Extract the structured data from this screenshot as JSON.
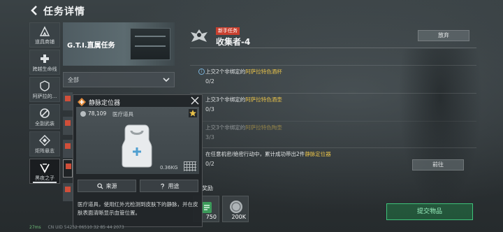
{
  "header": {
    "title": "任务详情"
  },
  "rail": {
    "items": [
      {
        "label": "道具商铺",
        "icon": "summit-icon"
      },
      {
        "label": "跨越生命线",
        "icon": "cross-icon"
      },
      {
        "label": "阿萨拉的...",
        "icon": "shield-icon"
      },
      {
        "label": "全副武装",
        "icon": "no-entry-icon"
      },
      {
        "label": "炬阵悬志",
        "icon": "diamond-icon"
      },
      {
        "label": "黑夜之子",
        "icon": "night-icon"
      }
    ]
  },
  "left_panel": {
    "banner_title": "G.T.I.直属任务",
    "filter_value": "全部"
  },
  "mission": {
    "tag": "新手任务",
    "title": "收集者-4",
    "abandon_label": "放弃",
    "objectives": [
      {
        "text_prefix": "上交2个非绑定的",
        "item": "阿萨拉特色酒杯",
        "count": "0/2",
        "done": false,
        "info": true
      },
      {
        "text_prefix": "上交3个非绑定的",
        "item": "阿萨拉特色酒壶",
        "count": "0/3",
        "done": false,
        "info": false
      },
      {
        "text_prefix": "上交3个非绑定的",
        "item": "阿萨拉特色陶壶",
        "count": "3/3",
        "done": true,
        "info": false
      },
      {
        "text_prefix": "在任意机密/绝密行动中，累计成功带出2件",
        "item": "静脉定位器",
        "count": "0/2",
        "done": false,
        "info": false
      }
    ],
    "goto_label": "前往",
    "reward_label": "奖励",
    "rewards": [
      {
        "amount": "750",
        "icon": "green-chip-icon"
      },
      {
        "amount": "200K",
        "icon": "silver-coin-icon"
      }
    ],
    "submit_label": "提交物品"
  },
  "popup": {
    "title": "静脉定位器",
    "price": "78,109",
    "category": "医疗道具",
    "weight": "0.36KG",
    "source_label": "来源",
    "use_label": "用途",
    "description": "医疗道具，使用红外光检测到皮肤下的静脉，并在皮肤表面清晰显示血管位置。",
    "colors": {
      "accent": "#e8c24a",
      "submit": "#3ec27a",
      "tag": "#c8402f"
    }
  },
  "footer": {
    "ping": "27ms",
    "uid": "CN UID 54252 06510 32 85 44 2073"
  }
}
